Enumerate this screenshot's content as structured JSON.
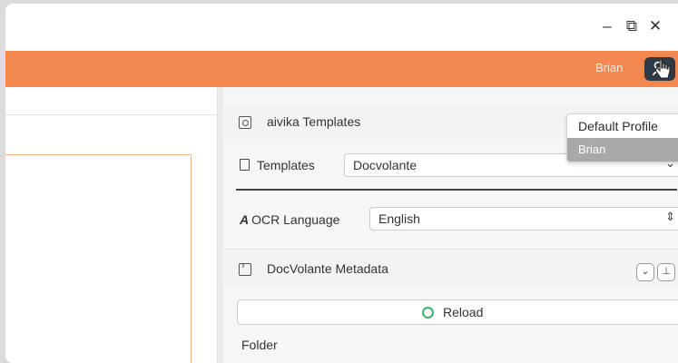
{
  "window": {
    "controls": {
      "minimize": "–",
      "maximize": "⧉",
      "close": "✕"
    }
  },
  "header": {
    "user_name": "Brian",
    "user_button_icon": "user-switch-icon",
    "accent_color": "#f2874f"
  },
  "profile_menu": {
    "items": [
      {
        "label": "Default Profile",
        "selected": false
      },
      {
        "label": "Brian",
        "selected": true
      }
    ]
  },
  "templates_section": {
    "title": "aivika Templates",
    "templates_label": "Templates",
    "templates_value": "Docvolante",
    "ocr_label": "OCR Language",
    "ocr_value": "English"
  },
  "metadata_section": {
    "title": "DocVolante Metadata",
    "collapse_symbol": "⌄",
    "pin_symbol": "⊥",
    "reload_label": "Reload",
    "folder_label": "Folder"
  }
}
